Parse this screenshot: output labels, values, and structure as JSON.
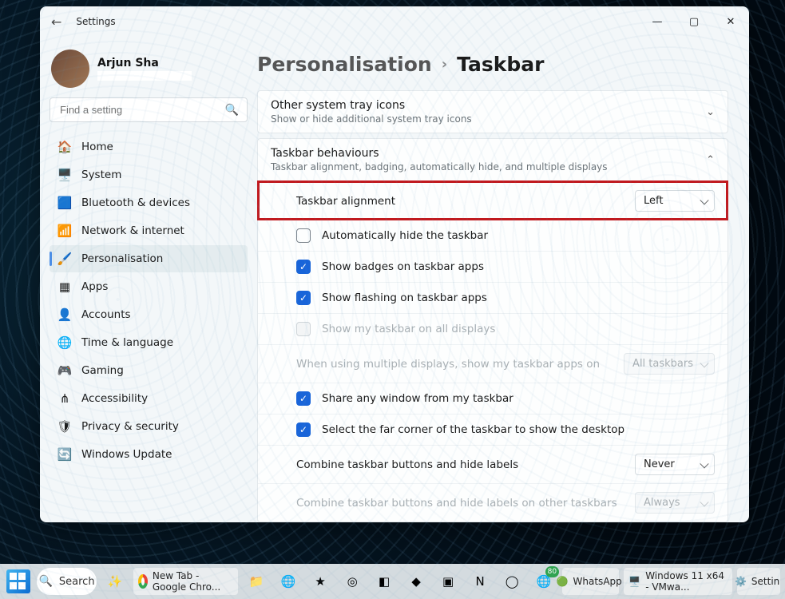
{
  "window": {
    "title": "Settings",
    "user_name": "Arjun Sha",
    "search_placeholder": "Find a setting"
  },
  "sidebar": {
    "items": [
      {
        "icon": "🏠",
        "label": "Home"
      },
      {
        "icon": "🖥️",
        "label": "System"
      },
      {
        "icon": "🟦",
        "label": "Bluetooth & devices",
        "icon_alt": "*"
      },
      {
        "icon": "📶",
        "label": "Network & internet"
      },
      {
        "icon": "🖌️",
        "label": "Personalisation",
        "active": true
      },
      {
        "icon": "▦",
        "label": "Apps"
      },
      {
        "icon": "👤",
        "label": "Accounts"
      },
      {
        "icon": "🌐",
        "label": "Time & language"
      },
      {
        "icon": "🎮",
        "label": "Gaming"
      },
      {
        "icon": "⋔",
        "label": "Accessibility"
      },
      {
        "icon": "🛡",
        "label": "Privacy & security"
      },
      {
        "icon": "🔄",
        "label": "Windows Update"
      }
    ]
  },
  "breadcrumb": {
    "parent": "Personalisation",
    "current": "Taskbar"
  },
  "cards": {
    "tray": {
      "title": "Other system tray icons",
      "subtitle": "Show or hide additional system tray icons"
    },
    "behav": {
      "title": "Taskbar behaviours",
      "subtitle": "Taskbar alignment, badging, automatically hide, and multiple displays"
    }
  },
  "rows": {
    "alignment": {
      "label": "Taskbar alignment",
      "value": "Left"
    },
    "autohide": {
      "label": "Automatically hide the taskbar",
      "checked": false
    },
    "badges": {
      "label": "Show badges on taskbar apps",
      "checked": true
    },
    "flashing": {
      "label": "Show flashing on taskbar apps",
      "checked": true
    },
    "multidisp": {
      "label": "Show my taskbar on all displays",
      "checked": false,
      "disabled": true
    },
    "whichdisp": {
      "label": "When using multiple displays, show my taskbar apps on",
      "value": "All taskbars",
      "disabled": true
    },
    "share": {
      "label": "Share any window from my taskbar",
      "checked": true
    },
    "farcorner": {
      "label": "Select the far corner of the taskbar to show the desktop",
      "checked": true
    },
    "combine": {
      "label": "Combine taskbar buttons and hide labels",
      "value": "Never"
    },
    "combine2": {
      "label": "Combine taskbar buttons and hide labels on other taskbars",
      "value": "Always",
      "disabled": true
    }
  },
  "taskbar": {
    "search_label": "Search",
    "tabs": [
      {
        "label": "New Tab - Google Chro..."
      },
      {
        "label": "WhatsApp"
      },
      {
        "label": "Windows 11 x64 - VMwa..."
      },
      {
        "label": "Settin"
      }
    ],
    "edge_badge": "80"
  }
}
